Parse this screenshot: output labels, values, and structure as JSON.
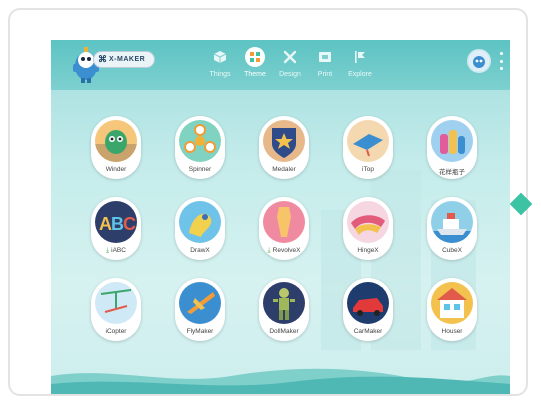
{
  "brand": {
    "name": "X-MAKER",
    "mark": "⌘"
  },
  "nav": [
    {
      "id": "things",
      "label": "Things"
    },
    {
      "id": "theme",
      "label": "Theme"
    },
    {
      "id": "design",
      "label": "Design"
    },
    {
      "id": "print",
      "label": "Print"
    },
    {
      "id": "explore",
      "label": "Explore"
    }
  ],
  "active_tab": "Theme",
  "apps": [
    {
      "label": "Winder"
    },
    {
      "label": "Spinner"
    },
    {
      "label": "Medaler"
    },
    {
      "label": "iTop"
    },
    {
      "label": "花样瓶子"
    },
    {
      "label": "iABC",
      "download": true
    },
    {
      "label": "DrawX"
    },
    {
      "label": "RevolveX",
      "download": true
    },
    {
      "label": "HingeX"
    },
    {
      "label": "CubeX"
    },
    {
      "label": "iCopter"
    },
    {
      "label": "FlyMaker"
    },
    {
      "label": "DollMaker"
    },
    {
      "label": "CarMaker"
    },
    {
      "label": "Houser"
    }
  ],
  "colors": {
    "topbar": "#5dc3c3",
    "background": "#c4eceb",
    "accent": "#3cc3a3"
  }
}
